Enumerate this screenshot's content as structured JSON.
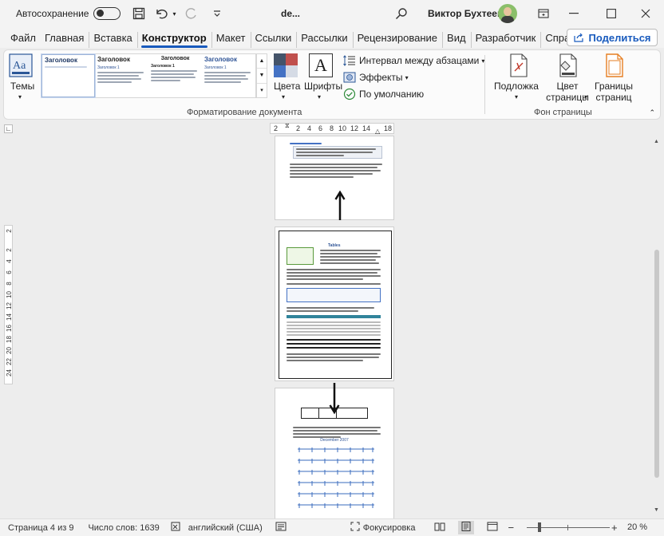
{
  "titlebar": {
    "autosave_label": "Автосохранение",
    "autosave_state": "off",
    "doc_name": "de...",
    "user_name": "Виктор Бухтеев",
    "buttons": [
      "ribbon-display-icon",
      "minimize-icon",
      "maximize-icon",
      "close-icon"
    ]
  },
  "tabs": [
    "Файл",
    "Главная",
    "Вставка",
    "Конструктор",
    "Макет",
    "Ссылки",
    "Рассылки",
    "Рецензирование",
    "Вид",
    "Разработчик",
    "Справка"
  ],
  "active_tab": "Конструктор",
  "share_label": "Поделиться",
  "ribbon": {
    "themes_label": "Темы",
    "gallery": [
      {
        "heading": "Заголовок",
        "sub": ""
      },
      {
        "heading": "Заголовок",
        "sub": "Заголовок 1"
      },
      {
        "heading": "Заголовок",
        "sub": "Заголовок 1"
      },
      {
        "heading": "Заголовок",
        "sub": "Заголовок 1"
      }
    ],
    "colors_label": "Цвета",
    "fonts_label": "Шрифты",
    "paragraph_spacing": "Интервал между абзацами",
    "effects": "Эффекты",
    "set_default": "По умолчанию",
    "group_format": "Форматирование документа",
    "watermark_label": "Подложка",
    "page_color_label": "Цвет страницы",
    "page_borders_label": "Границы страниц",
    "group_background": "Фон страницы"
  },
  "ruler_top": [
    "2",
    "2",
    "4",
    "6",
    "8",
    "10",
    "12",
    "14",
    "18"
  ],
  "ruler_left": [
    "2",
    "2",
    "4",
    "6",
    "8",
    "10",
    "12",
    "14",
    "16",
    "18",
    "20",
    "22",
    "24"
  ],
  "pages": {
    "page2_heading": "Tables",
    "page3_heading": "December 2007"
  },
  "status": {
    "page": "Страница 4 из 9",
    "words": "Число слов: 1639",
    "language": "английский (США)",
    "focus": "Фокусировка",
    "zoom": "20 %"
  }
}
